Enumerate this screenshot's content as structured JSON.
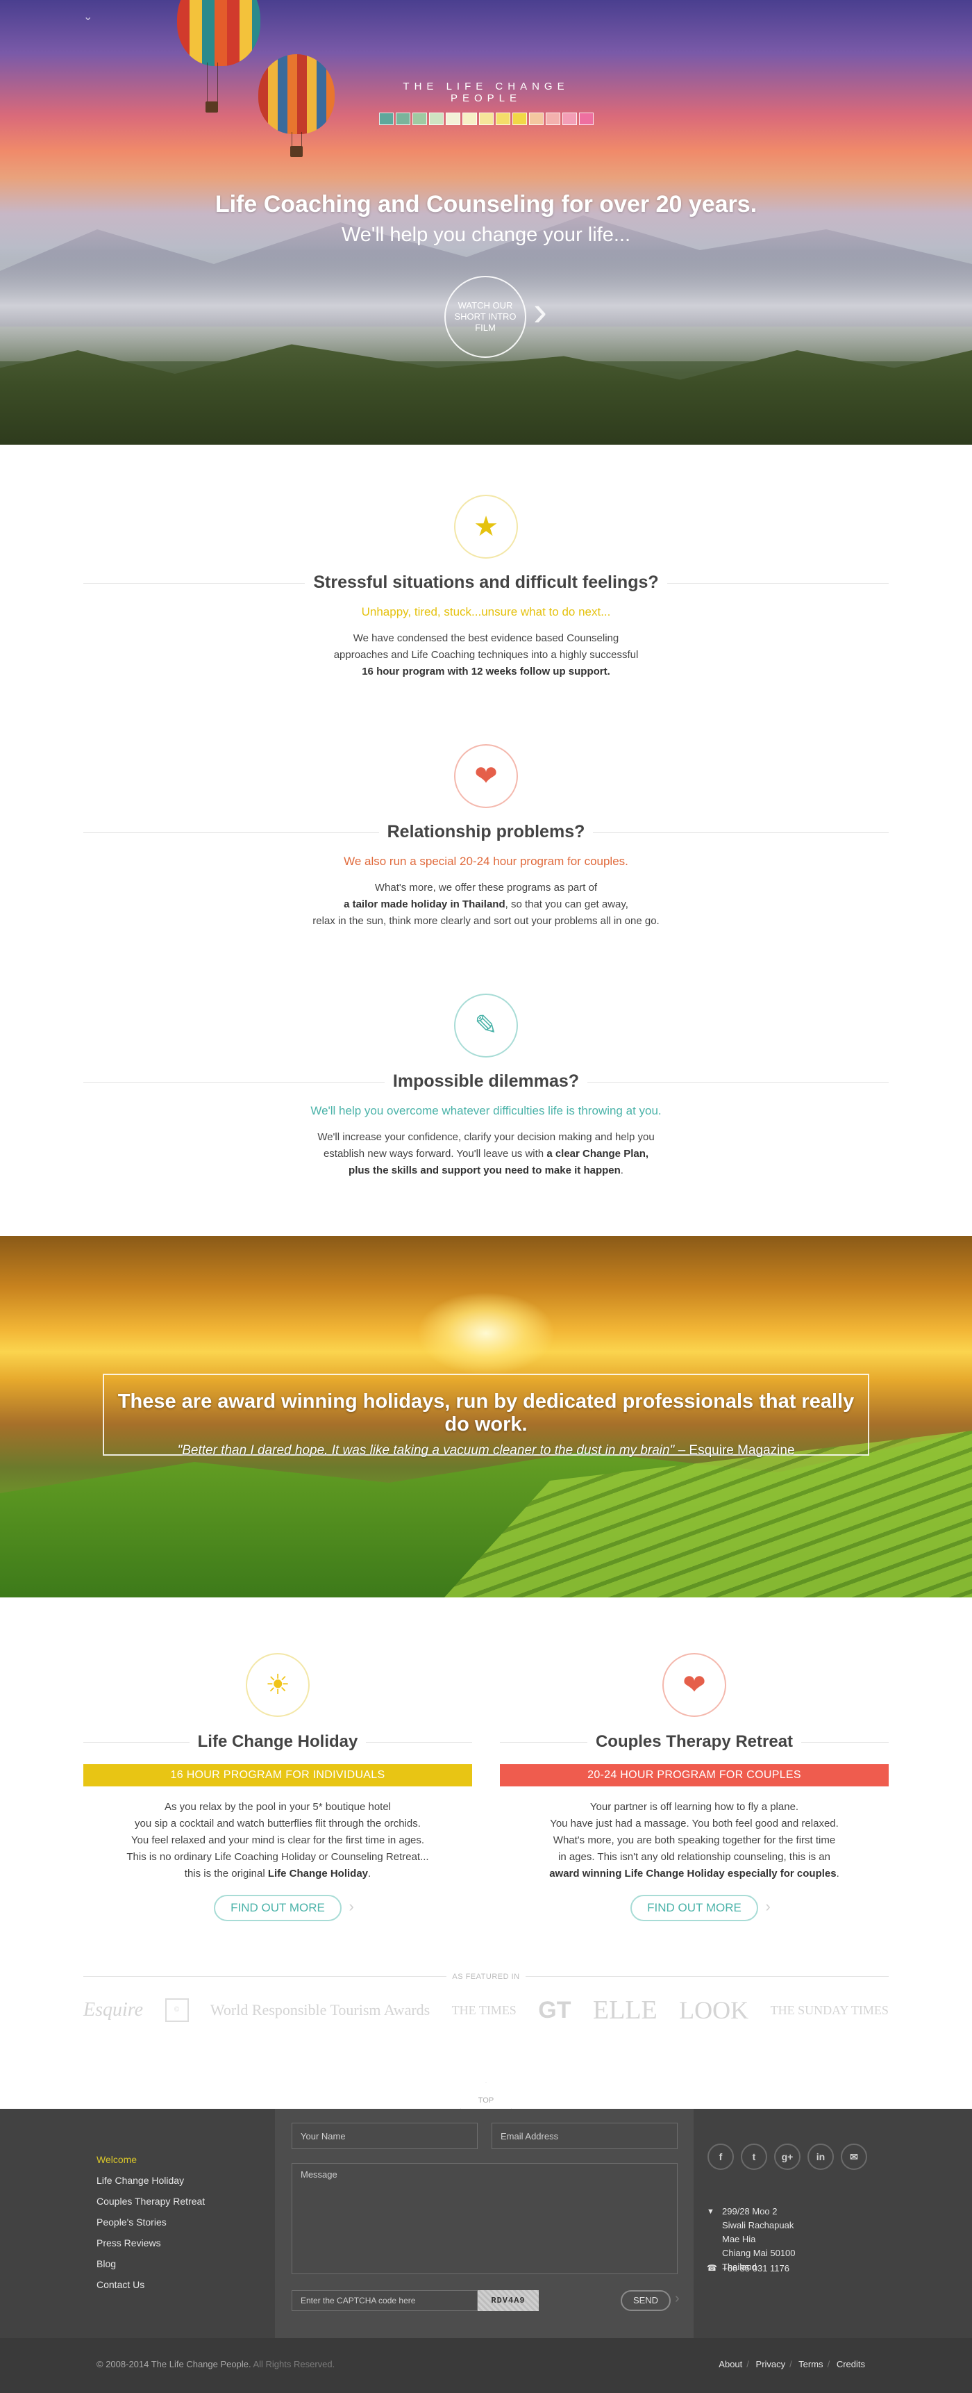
{
  "hero": {
    "brand_name": "THE LIFE CHANGE PEOPLE",
    "swatch_colors": [
      "#5fa79b",
      "#7ab49b",
      "#9fcaa2",
      "#cfe3c2",
      "#f3f1d8",
      "#f7f0c6",
      "#f6e59a",
      "#f4dd6a",
      "#f1d847",
      "#f4c7a0",
      "#f3b1ae",
      "#f39eb6",
      "#ee6fa0"
    ],
    "title": "Life Coaching and Counseling for over 20 years.",
    "subtitle": "We'll help you change your life...",
    "watch_label": "WATCH OUR SHORT INTRO FILM"
  },
  "features": [
    {
      "icon": "jumping-figure-icon",
      "color": "#e5c20f",
      "title": "Stressful situations and difficult feelings?",
      "tagline": "Unhappy, tired, stuck...unsure what to do next...",
      "body_line1": "We have condensed the best evidence based Counseling",
      "body_line2": "approaches and Life Coaching techniques into a highly successful",
      "body_bold": "16 hour program with 12 weeks follow up support."
    },
    {
      "icon": "broken-heart-icon",
      "color": "#e55f4a",
      "title": "Relationship problems?",
      "tagline": "We also run a special 20-24 hour program for couples.",
      "body_line1": "What's more, we offer these programs as part of",
      "body_bold": "a tailor made holiday in Thailand",
      "body_line2_tail": ", so that you can get away,",
      "body_line3": "relax in the sun, think more clearly and sort out your problems all in one go."
    },
    {
      "icon": "puzzle-figure-icon",
      "color": "#4bb3a9",
      "title": "Impossible dilemmas?",
      "tagline": "We'll help you overcome whatever difficulties life is throwing at you.",
      "body_line1": "We'll increase your confidence, clarify your decision making and help you",
      "body_line2_head": "establish new ways forward. You'll leave us with ",
      "body_bold1": "a clear Change Plan,",
      "body_bold2": "plus the skills and support you need to make it happen",
      "body_tail": "."
    }
  ],
  "banner": {
    "title": "These are award winning holidays, run by dedicated professionals that really do work.",
    "quote": "\"Better than I dared hope. It was like taking a vacuum cleaner to the dust in my brain\"",
    "source": " – Esquire Magazine"
  },
  "programs": [
    {
      "icon": "sun-icon",
      "color": "#e5c20f",
      "bar_color": "#e8c514",
      "title": "Life Change Holiday",
      "bar_label": "16 HOUR PROGRAM FOR INDIVIDUALS",
      "line1": "As you relax by the pool in your 5* boutique hotel",
      "line2": "you sip a cocktail and watch butterflies flit through the orchids.",
      "line3": "You feel relaxed and your mind is clear for the first time in ages.",
      "line4": "This is no ordinary Life Coaching Holiday or Counseling Retreat...",
      "line5_head": "this is the original ",
      "line5_bold": "Life Change Holiday",
      "line5_tail": ".",
      "button": "FIND OUT MORE"
    },
    {
      "icon": "hearts-bubble-icon",
      "color": "#e55f4a",
      "bar_color": "#ef5c4e",
      "title": "Couples Therapy Retreat",
      "bar_label": "20-24 HOUR PROGRAM FOR COUPLES",
      "line1": "Your partner is off learning how to fly a plane.",
      "line2": "You have just had a massage. You both feel good and relaxed.",
      "line3": "What's more, you are both speaking together for the first time",
      "line4": "in ages. This isn't any old relationship counseling, this is an",
      "line5_bold": "award winning Life Change Holiday especially for couples",
      "line5_tail": ".",
      "button": "FIND OUT MORE"
    }
  ],
  "featured": {
    "label": "AS FEATURED IN",
    "logos": [
      "Esquire",
      "©",
      "World Responsible Tourism Awards",
      "THE TIMES",
      "GT",
      "ELLE",
      "LOOK",
      "THE SUNDAY TIMES"
    ]
  },
  "top_label": "TOP",
  "footer": {
    "nav": [
      "Welcome",
      "Life Change Holiday",
      "Couples Therapy Retreat",
      "People's Stories",
      "Press Reviews",
      "Blog",
      "Contact Us"
    ],
    "name_placeholder": "Your Name",
    "email_placeholder": "Email Address",
    "message_placeholder": "Message",
    "captcha_placeholder": "Enter the CAPTCHA code here",
    "captcha_code": "RDV4A9",
    "send_label": "SEND",
    "social": [
      "f",
      "t",
      "g+",
      "in",
      "✉"
    ],
    "social_icons": [
      "facebook-icon",
      "twitter-icon",
      "google-plus-icon",
      "linkedin-icon",
      "email-icon"
    ],
    "address": [
      "299/28 Moo 2",
      "Siwali Rachapuak",
      "Mae Hia",
      "Chiang Mai 50100",
      "Thailand"
    ],
    "phone": "+66 85 031 1176"
  },
  "bottom": {
    "copyright": "© 2008-2014 The Life Change People.",
    "rights": " All Rights Reserved.",
    "links": [
      "About",
      "Privacy",
      "Terms",
      "Credits"
    ]
  }
}
